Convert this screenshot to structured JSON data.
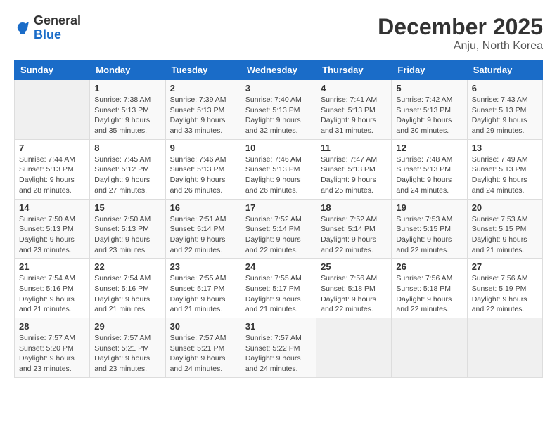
{
  "logo": {
    "general": "General",
    "blue": "Blue"
  },
  "header": {
    "month_year": "December 2025",
    "location": "Anju, North Korea"
  },
  "weekdays": [
    "Sunday",
    "Monday",
    "Tuesday",
    "Wednesday",
    "Thursday",
    "Friday",
    "Saturday"
  ],
  "weeks": [
    [
      {
        "day": "",
        "info": ""
      },
      {
        "day": "1",
        "info": "Sunrise: 7:38 AM\nSunset: 5:13 PM\nDaylight: 9 hours\nand 35 minutes."
      },
      {
        "day": "2",
        "info": "Sunrise: 7:39 AM\nSunset: 5:13 PM\nDaylight: 9 hours\nand 33 minutes."
      },
      {
        "day": "3",
        "info": "Sunrise: 7:40 AM\nSunset: 5:13 PM\nDaylight: 9 hours\nand 32 minutes."
      },
      {
        "day": "4",
        "info": "Sunrise: 7:41 AM\nSunset: 5:13 PM\nDaylight: 9 hours\nand 31 minutes."
      },
      {
        "day": "5",
        "info": "Sunrise: 7:42 AM\nSunset: 5:13 PM\nDaylight: 9 hours\nand 30 minutes."
      },
      {
        "day": "6",
        "info": "Sunrise: 7:43 AM\nSunset: 5:13 PM\nDaylight: 9 hours\nand 29 minutes."
      }
    ],
    [
      {
        "day": "7",
        "info": "Sunrise: 7:44 AM\nSunset: 5:13 PM\nDaylight: 9 hours\nand 28 minutes."
      },
      {
        "day": "8",
        "info": "Sunrise: 7:45 AM\nSunset: 5:12 PM\nDaylight: 9 hours\nand 27 minutes."
      },
      {
        "day": "9",
        "info": "Sunrise: 7:46 AM\nSunset: 5:13 PM\nDaylight: 9 hours\nand 26 minutes."
      },
      {
        "day": "10",
        "info": "Sunrise: 7:46 AM\nSunset: 5:13 PM\nDaylight: 9 hours\nand 26 minutes."
      },
      {
        "day": "11",
        "info": "Sunrise: 7:47 AM\nSunset: 5:13 PM\nDaylight: 9 hours\nand 25 minutes."
      },
      {
        "day": "12",
        "info": "Sunrise: 7:48 AM\nSunset: 5:13 PM\nDaylight: 9 hours\nand 24 minutes."
      },
      {
        "day": "13",
        "info": "Sunrise: 7:49 AM\nSunset: 5:13 PM\nDaylight: 9 hours\nand 24 minutes."
      }
    ],
    [
      {
        "day": "14",
        "info": "Sunrise: 7:50 AM\nSunset: 5:13 PM\nDaylight: 9 hours\nand 23 minutes."
      },
      {
        "day": "15",
        "info": "Sunrise: 7:50 AM\nSunset: 5:13 PM\nDaylight: 9 hours\nand 23 minutes."
      },
      {
        "day": "16",
        "info": "Sunrise: 7:51 AM\nSunset: 5:14 PM\nDaylight: 9 hours\nand 22 minutes."
      },
      {
        "day": "17",
        "info": "Sunrise: 7:52 AM\nSunset: 5:14 PM\nDaylight: 9 hours\nand 22 minutes."
      },
      {
        "day": "18",
        "info": "Sunrise: 7:52 AM\nSunset: 5:14 PM\nDaylight: 9 hours\nand 22 minutes."
      },
      {
        "day": "19",
        "info": "Sunrise: 7:53 AM\nSunset: 5:15 PM\nDaylight: 9 hours\nand 22 minutes."
      },
      {
        "day": "20",
        "info": "Sunrise: 7:53 AM\nSunset: 5:15 PM\nDaylight: 9 hours\nand 21 minutes."
      }
    ],
    [
      {
        "day": "21",
        "info": "Sunrise: 7:54 AM\nSunset: 5:16 PM\nDaylight: 9 hours\nand 21 minutes."
      },
      {
        "day": "22",
        "info": "Sunrise: 7:54 AM\nSunset: 5:16 PM\nDaylight: 9 hours\nand 21 minutes."
      },
      {
        "day": "23",
        "info": "Sunrise: 7:55 AM\nSunset: 5:17 PM\nDaylight: 9 hours\nand 21 minutes."
      },
      {
        "day": "24",
        "info": "Sunrise: 7:55 AM\nSunset: 5:17 PM\nDaylight: 9 hours\nand 21 minutes."
      },
      {
        "day": "25",
        "info": "Sunrise: 7:56 AM\nSunset: 5:18 PM\nDaylight: 9 hours\nand 22 minutes."
      },
      {
        "day": "26",
        "info": "Sunrise: 7:56 AM\nSunset: 5:18 PM\nDaylight: 9 hours\nand 22 minutes."
      },
      {
        "day": "27",
        "info": "Sunrise: 7:56 AM\nSunset: 5:19 PM\nDaylight: 9 hours\nand 22 minutes."
      }
    ],
    [
      {
        "day": "28",
        "info": "Sunrise: 7:57 AM\nSunset: 5:20 PM\nDaylight: 9 hours\nand 23 minutes."
      },
      {
        "day": "29",
        "info": "Sunrise: 7:57 AM\nSunset: 5:21 PM\nDaylight: 9 hours\nand 23 minutes."
      },
      {
        "day": "30",
        "info": "Sunrise: 7:57 AM\nSunset: 5:21 PM\nDaylight: 9 hours\nand 24 minutes."
      },
      {
        "day": "31",
        "info": "Sunrise: 7:57 AM\nSunset: 5:22 PM\nDaylight: 9 hours\nand 24 minutes."
      },
      {
        "day": "",
        "info": ""
      },
      {
        "day": "",
        "info": ""
      },
      {
        "day": "",
        "info": ""
      }
    ]
  ]
}
